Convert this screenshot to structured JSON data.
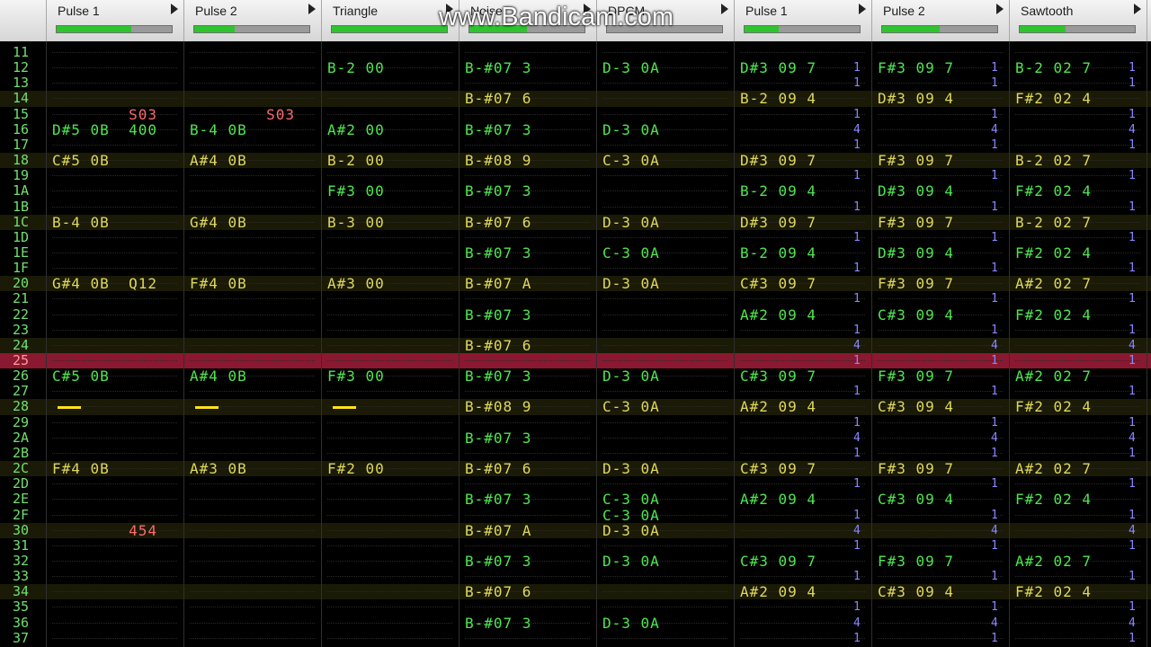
{
  "watermark": "www.Bandicam.com",
  "channels": [
    {
      "name": "Pulse 1",
      "meter": 0.65
    },
    {
      "name": "Pulse 2",
      "meter": 0.35
    },
    {
      "name": "Triangle",
      "meter": 1.0
    },
    {
      "name": "Noise",
      "meter": 0.5
    },
    {
      "name": "DPCM",
      "meter": 0.0
    },
    {
      "name": "Pulse 1",
      "meter": 0.3
    },
    {
      "name": "Pulse 2",
      "meter": 0.5
    },
    {
      "name": "Sawtooth",
      "meter": 0.4
    }
  ],
  "current_row": "25",
  "rows": [
    {
      "n": "11",
      "hl": false,
      "c": []
    },
    {
      "n": "12",
      "hl": false,
      "c": [
        [
          2,
          "B-2 00",
          "g"
        ],
        [
          3,
          "B-#07 3",
          "g"
        ],
        [
          4,
          "D-3 0A",
          "g"
        ],
        [
          5,
          "D#3 09 7",
          "g"
        ],
        [
          6,
          "F#3 09 7",
          "g"
        ],
        [
          7,
          "B-2 02 7",
          "g"
        ]
      ]
    },
    {
      "n": "13",
      "hl": false,
      "c": []
    },
    {
      "n": "14",
      "hl": true,
      "c": [
        [
          3,
          "B-#07 6",
          "y"
        ],
        [
          5,
          "B-2 09 4",
          "y"
        ],
        [
          6,
          "D#3 09 4",
          "y"
        ],
        [
          7,
          "F#2 02 4",
          "y"
        ]
      ]
    },
    {
      "n": "15",
      "hl": false,
      "c": [
        [
          0,
          "        S03",
          "r"
        ],
        [
          1,
          "        S03",
          "r"
        ]
      ]
    },
    {
      "n": "16",
      "hl": false,
      "c": [
        [
          0,
          "D#5 0B  400",
          "g"
        ],
        [
          1,
          "B-4 0B",
          "g"
        ],
        [
          2,
          "A#2 00",
          "g"
        ],
        [
          3,
          "B-#07 3",
          "g"
        ],
        [
          4,
          "D-3 0A",
          "g"
        ]
      ]
    },
    {
      "n": "17",
      "hl": false,
      "c": []
    },
    {
      "n": "18",
      "hl": true,
      "c": [
        [
          0,
          "C#5 0B",
          "y"
        ],
        [
          1,
          "A#4 0B",
          "y"
        ],
        [
          2,
          "B-2 00",
          "y"
        ],
        [
          3,
          "B-#08 9",
          "y"
        ],
        [
          4,
          "C-3 0A",
          "y"
        ],
        [
          5,
          "D#3 09 7",
          "y"
        ],
        [
          6,
          "F#3 09 7",
          "y"
        ],
        [
          7,
          "B-2 02 7",
          "y"
        ]
      ]
    },
    {
      "n": "19",
      "hl": false,
      "c": []
    },
    {
      "n": "1A",
      "hl": false,
      "c": [
        [
          2,
          "F#3 00",
          "g"
        ],
        [
          3,
          "B-#07 3",
          "g"
        ],
        [
          5,
          "B-2 09 4",
          "g"
        ],
        [
          6,
          "D#3 09 4",
          "g"
        ],
        [
          7,
          "F#2 02 4",
          "g"
        ]
      ]
    },
    {
      "n": "1B",
      "hl": false,
      "c": []
    },
    {
      "n": "1C",
      "hl": true,
      "c": [
        [
          0,
          "B-4 0B",
          "y"
        ],
        [
          1,
          "G#4 0B",
          "y"
        ],
        [
          2,
          "B-3 00",
          "y"
        ],
        [
          3,
          "B-#07 6",
          "y"
        ],
        [
          4,
          "D-3 0A",
          "y"
        ],
        [
          5,
          "D#3 09 7",
          "y"
        ],
        [
          6,
          "F#3 09 7",
          "y"
        ],
        [
          7,
          "B-2 02 7",
          "y"
        ]
      ]
    },
    {
      "n": "1D",
      "hl": false,
      "c": []
    },
    {
      "n": "1E",
      "hl": false,
      "c": [
        [
          3,
          "B-#07 3",
          "g"
        ],
        [
          4,
          "C-3 0A",
          "g"
        ],
        [
          5,
          "B-2 09 4",
          "g"
        ],
        [
          6,
          "D#3 09 4",
          "g"
        ],
        [
          7,
          "F#2 02 4",
          "g"
        ]
      ]
    },
    {
      "n": "1F",
      "hl": false,
      "c": []
    },
    {
      "n": "20",
      "hl": true,
      "c": [
        [
          0,
          "G#4 0B  Q12",
          "y"
        ],
        [
          1,
          "F#4 0B",
          "y"
        ],
        [
          2,
          "A#3 00",
          "y"
        ],
        [
          3,
          "B-#07 A",
          "y"
        ],
        [
          4,
          "D-3 0A",
          "y"
        ],
        [
          5,
          "C#3 09 7",
          "y"
        ],
        [
          6,
          "F#3 09 7",
          "y"
        ],
        [
          7,
          "A#2 02 7",
          "y"
        ]
      ]
    },
    {
      "n": "21",
      "hl": false,
      "c": []
    },
    {
      "n": "22",
      "hl": false,
      "c": [
        [
          3,
          "B-#07 3",
          "g"
        ],
        [
          5,
          "A#2 09 4",
          "g"
        ],
        [
          6,
          "C#3 09 4",
          "g"
        ],
        [
          7,
          "F#2 02 4",
          "g"
        ]
      ]
    },
    {
      "n": "23",
      "hl": false,
      "c": []
    },
    {
      "n": "24",
      "hl": true,
      "c": [
        [
          3,
          "B-#07 6",
          "y"
        ]
      ]
    },
    {
      "n": "25",
      "hl": false,
      "c": []
    },
    {
      "n": "26",
      "hl": false,
      "c": [
        [
          0,
          "C#5 0B",
          "g"
        ],
        [
          1,
          "A#4 0B",
          "g"
        ],
        [
          2,
          "F#3 00",
          "g"
        ],
        [
          3,
          "B-#07 3",
          "g"
        ],
        [
          4,
          "D-3 0A",
          "g"
        ],
        [
          5,
          "C#3 09 7",
          "g"
        ],
        [
          6,
          "F#3 09 7",
          "g"
        ],
        [
          7,
          "A#2 02 7",
          "g"
        ]
      ]
    },
    {
      "n": "27",
      "hl": false,
      "c": []
    },
    {
      "n": "28",
      "hl": true,
      "c": [
        [
          3,
          "B-#08 9",
          "y"
        ],
        [
          4,
          "C-3 0A",
          "y"
        ],
        [
          5,
          "A#2 09 4",
          "y"
        ],
        [
          6,
          "C#3 09 4",
          "y"
        ],
        [
          7,
          "F#2 02 4",
          "y"
        ]
      ]
    },
    {
      "n": "29",
      "hl": false,
      "c": []
    },
    {
      "n": "2A",
      "hl": false,
      "c": [
        [
          3,
          "B-#07 3",
          "g"
        ]
      ]
    },
    {
      "n": "2B",
      "hl": false,
      "c": []
    },
    {
      "n": "2C",
      "hl": true,
      "c": [
        [
          0,
          "F#4 0B",
          "y"
        ],
        [
          1,
          "A#3 0B",
          "y"
        ],
        [
          2,
          "F#2 00",
          "y"
        ],
        [
          3,
          "B-#07 6",
          "y"
        ],
        [
          4,
          "D-3 0A",
          "y"
        ],
        [
          5,
          "C#3 09 7",
          "y"
        ],
        [
          6,
          "F#3 09 7",
          "y"
        ],
        [
          7,
          "A#2 02 7",
          "y"
        ]
      ]
    },
    {
      "n": "2D",
      "hl": false,
      "c": []
    },
    {
      "n": "2E",
      "hl": false,
      "c": [
        [
          3,
          "B-#07 3",
          "g"
        ],
        [
          4,
          "C-3 0A",
          "g"
        ],
        [
          5,
          "A#2 09 4",
          "g"
        ],
        [
          6,
          "C#3 09 4",
          "g"
        ],
        [
          7,
          "F#2 02 4",
          "g"
        ]
      ]
    },
    {
      "n": "2F",
      "hl": false,
      "c": [
        [
          4,
          "C-3 0A",
          "g"
        ]
      ]
    },
    {
      "n": "30",
      "hl": true,
      "c": [
        [
          0,
          "        454",
          "r"
        ],
        [
          3,
          "B-#07 A",
          "y"
        ],
        [
          4,
          "D-3 0A",
          "y"
        ]
      ]
    },
    {
      "n": "31",
      "hl": false,
      "c": []
    },
    {
      "n": "32",
      "hl": false,
      "c": [
        [
          3,
          "B-#07 3",
          "g"
        ],
        [
          4,
          "D-3 0A",
          "g"
        ],
        [
          5,
          "C#3 09 7",
          "g"
        ],
        [
          6,
          "F#3 09 7",
          "g"
        ],
        [
          7,
          "A#2 02 7",
          "g"
        ]
      ]
    },
    {
      "n": "33",
      "hl": false,
      "c": []
    },
    {
      "n": "34",
      "hl": true,
      "c": [
        [
          3,
          "B-#07 6",
          "y"
        ],
        [
          5,
          "A#2 09 4",
          "y"
        ],
        [
          6,
          "C#3 09 4",
          "y"
        ],
        [
          7,
          "F#2 02 4",
          "y"
        ]
      ]
    },
    {
      "n": "35",
      "hl": false,
      "c": []
    },
    {
      "n": "36",
      "hl": false,
      "c": [
        [
          3,
          "B-#07 3",
          "g"
        ],
        [
          4,
          "D-3 0A",
          "g"
        ]
      ]
    },
    {
      "n": "37",
      "hl": false,
      "c": []
    }
  ],
  "vol_markers": [
    [
      "12",
      "1"
    ],
    [
      "13",
      "1"
    ],
    [
      "15",
      "1"
    ],
    [
      "16",
      "4"
    ],
    [
      "17",
      "1"
    ],
    [
      "19",
      "1"
    ],
    [
      "1B",
      "1"
    ],
    [
      "1D",
      "1"
    ],
    [
      "1F",
      "1"
    ],
    [
      "21",
      "1"
    ],
    [
      "23",
      "1"
    ],
    [
      "24",
      "4"
    ],
    [
      "25",
      "1"
    ],
    [
      "27",
      "1"
    ],
    [
      "29",
      "1"
    ],
    [
      "2A",
      "4"
    ],
    [
      "2B",
      "1"
    ],
    [
      "2D",
      "1"
    ],
    [
      "2F",
      "1"
    ],
    [
      "30",
      "4"
    ],
    [
      "31",
      "1"
    ],
    [
      "33",
      "1"
    ],
    [
      "35",
      "1"
    ],
    [
      "36",
      "4"
    ],
    [
      "37",
      "1"
    ]
  ],
  "note_off_row": "28",
  "colors": {
    "green": "#4fe64f",
    "yellow": "#e0d85a",
    "red": "#ff6a6a",
    "blue": "#8a86ff",
    "cursor_row": "#8a1830"
  }
}
